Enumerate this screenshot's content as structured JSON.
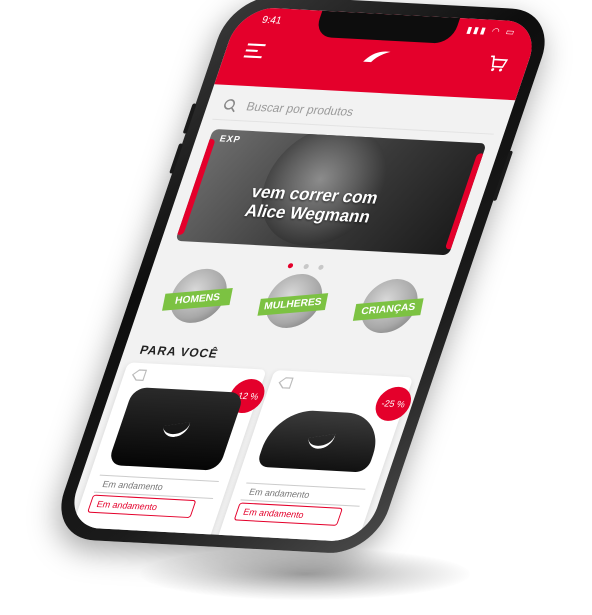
{
  "colors": {
    "brand": "#e4002b",
    "category_label": "#7cc242",
    "background": "#f2f2f2"
  },
  "status_bar": {
    "time": "9:41"
  },
  "header": {
    "menu_icon": "hamburger-menu-icon",
    "logo_icon": "brand-swoosh-logo",
    "cart_icon": "shopping-cart-icon"
  },
  "search": {
    "placeholder": "Buscar por produtos",
    "icon": "search-icon"
  },
  "banner": {
    "badge": "EXP",
    "line1": "vem correr com",
    "line2": "Alice Wegmann"
  },
  "carousel": {
    "active_index": 0,
    "count": 3
  },
  "categories": [
    {
      "label": "HOMENS"
    },
    {
      "label": "MULHERES"
    },
    {
      "label": "CRIANÇAS"
    }
  ],
  "section": {
    "title": "PARA VOCÊ"
  },
  "products": [
    {
      "discount": "-12 %",
      "status_gray": "Em andamento",
      "status_red": "Em andamento",
      "image": "black-sports-bag"
    },
    {
      "discount": "-25 %",
      "status_gray": "Em andamento",
      "status_red": "Em andamento",
      "image": "black-running-shoe"
    }
  ]
}
